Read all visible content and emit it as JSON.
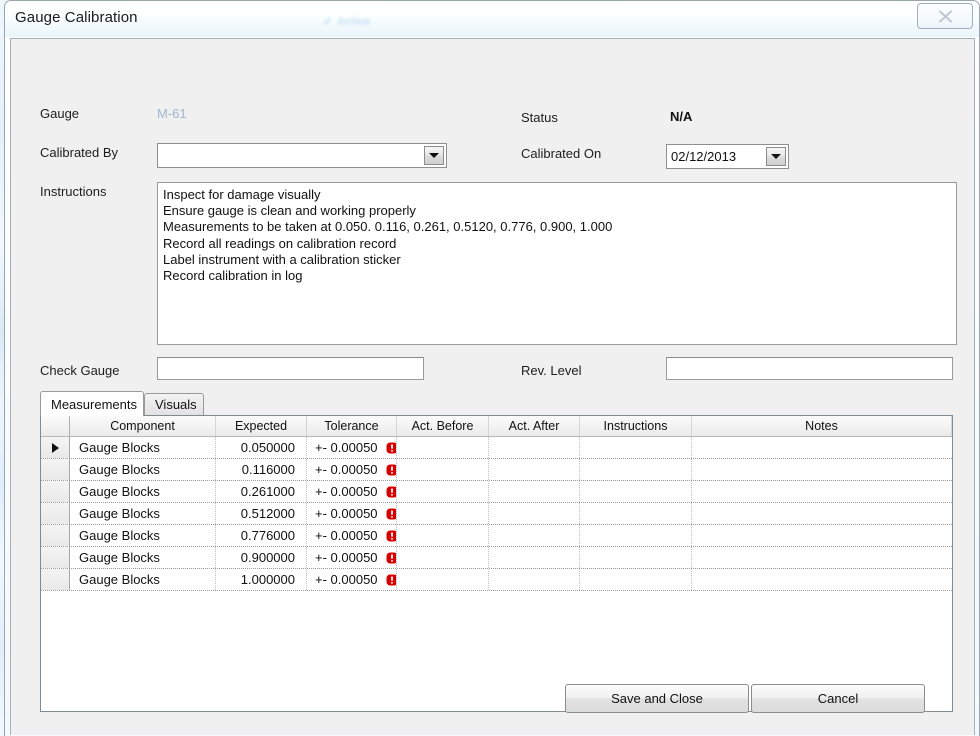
{
  "window": {
    "title": "Gauge Calibration",
    "watermark": "Active",
    "close_icon": "close-x-icon"
  },
  "form": {
    "gauge_label": "Gauge",
    "gauge_value": "M-61",
    "gauge_value_color": "#9fb6cc",
    "calibrated_by_label": "Calibrated By",
    "calibrated_by_value": "",
    "calibrated_by_placeholder": "",
    "status_label": "Status",
    "status_value": "N/A",
    "calibrated_on_label": "Calibrated On",
    "calibrated_on_value": "02/12/2013",
    "instructions_label": "Instructions",
    "instructions_text": "Inspect for damage visually\nEnsure gauge is clean and working properly\nMeasurements to be taken at 0.050. 0.116, 0.261, 0.5120, 0.776, 0.900, 1.000\nRecord all readings on calibration record\nLabel instrument with a calibration sticker\nRecord calibration in log",
    "check_gauge_label": "Check Gauge",
    "check_gauge_value": "",
    "rev_level_label": "Rev. Level",
    "rev_level_value": ""
  },
  "tabs": [
    {
      "label": "Measurements",
      "active": true
    },
    {
      "label": "Visuals",
      "active": false
    }
  ],
  "grid": {
    "columns": [
      "Component",
      "Expected",
      "Tolerance",
      "Act. Before",
      "Act. After",
      "Instructions",
      "Notes"
    ],
    "selected_row_index": 0,
    "error_icon": "error-exclamation-icon",
    "error_color": "#d70000",
    "rows": [
      {
        "component": "Gauge Blocks",
        "expected": "0.050000",
        "tolerance": "+- 0.00050",
        "act_before": "",
        "act_after": "",
        "instructions": "",
        "notes": "",
        "has_error": true
      },
      {
        "component": "Gauge Blocks",
        "expected": "0.116000",
        "tolerance": "+- 0.00050",
        "act_before": "",
        "act_after": "",
        "instructions": "",
        "notes": "",
        "has_error": true
      },
      {
        "component": "Gauge Blocks",
        "expected": "0.261000",
        "tolerance": "+- 0.00050",
        "act_before": "",
        "act_after": "",
        "instructions": "",
        "notes": "",
        "has_error": true
      },
      {
        "component": "Gauge Blocks",
        "expected": "0.512000",
        "tolerance": "+- 0.00050",
        "act_before": "",
        "act_after": "",
        "instructions": "",
        "notes": "",
        "has_error": true
      },
      {
        "component": "Gauge Blocks",
        "expected": "0.776000",
        "tolerance": "+- 0.00050",
        "act_before": "",
        "act_after": "",
        "instructions": "",
        "notes": "",
        "has_error": true
      },
      {
        "component": "Gauge Blocks",
        "expected": "0.900000",
        "tolerance": "+- 0.00050",
        "act_before": "",
        "act_after": "",
        "instructions": "",
        "notes": "",
        "has_error": true
      },
      {
        "component": "Gauge Blocks",
        "expected": "1.000000",
        "tolerance": "+- 0.00050",
        "act_before": "",
        "act_after": "",
        "instructions": "",
        "notes": "",
        "has_error": true
      }
    ]
  },
  "footer": {
    "save_label": "Save and Close",
    "cancel_label": "Cancel"
  }
}
